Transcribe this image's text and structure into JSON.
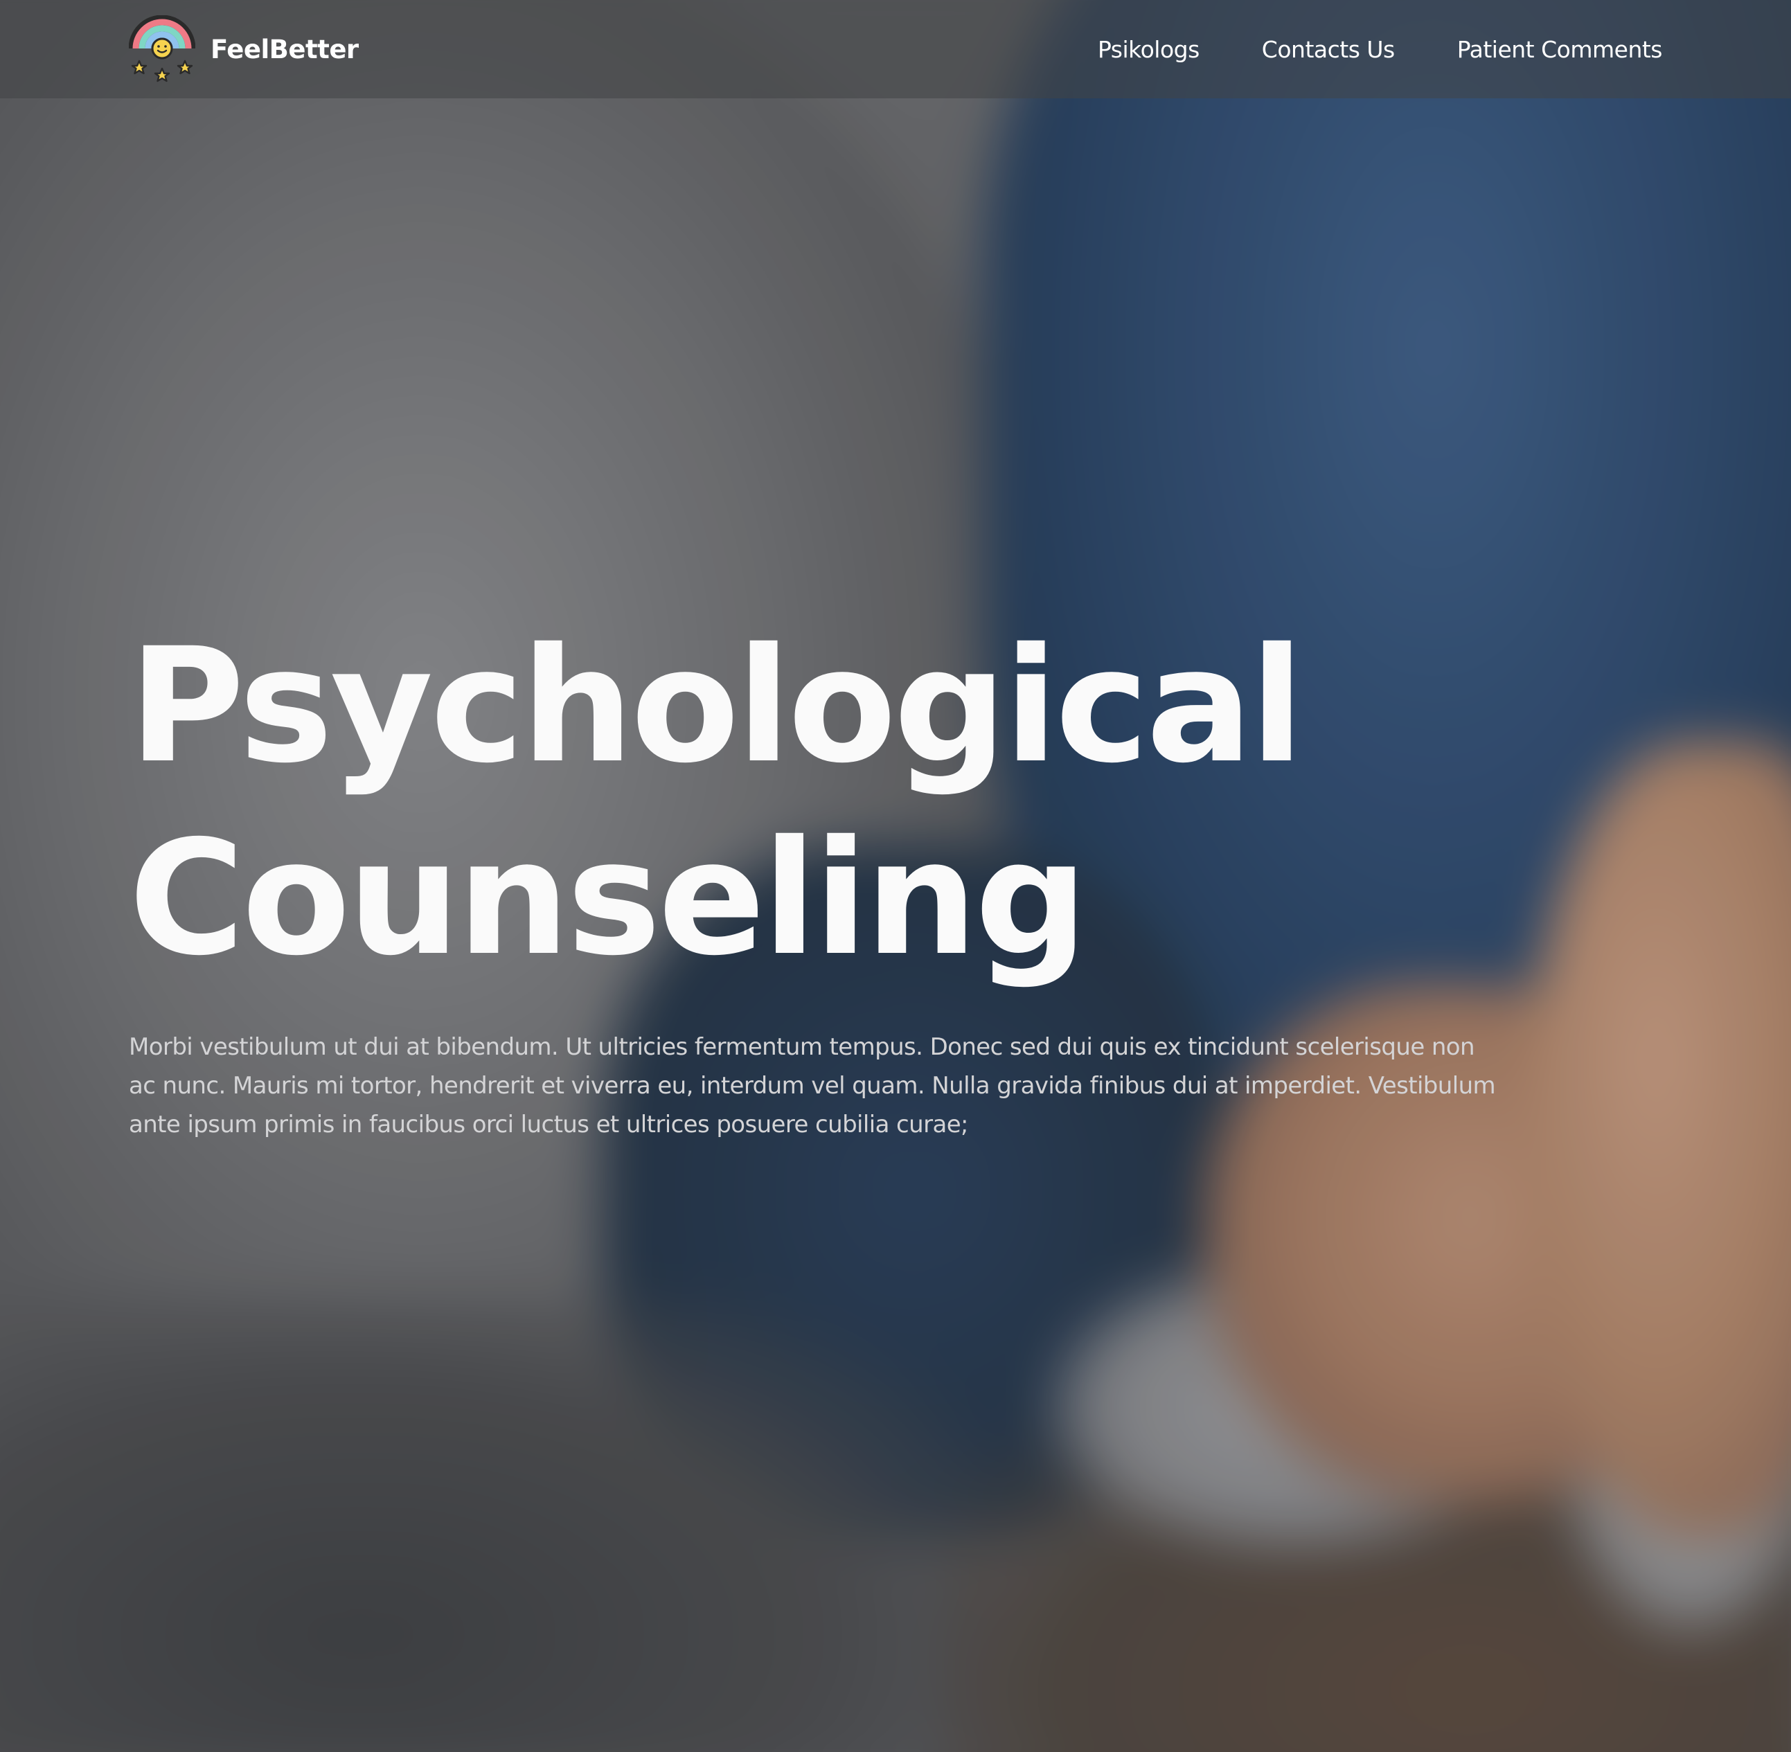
{
  "brand": {
    "name": "FeelBetter",
    "logo_icon": "rainbow-smiley-stars-icon"
  },
  "nav": {
    "items": [
      {
        "label": "Psikologs"
      },
      {
        "label": "Contacts Us"
      },
      {
        "label": "Patient Comments"
      }
    ]
  },
  "hero": {
    "title_line1": "Psychological",
    "title_line2": "Counseling",
    "description": "Morbi vestibulum ut dui at bibendum. Ut ultricies fermentum tempus. Donec sed dui quis ex tincidunt scelerisque non ac nunc. Mauris mi tortor, hendrerit et viverra eu, interdum vel quam. Nulla gravida finibus dui at imperdiet. Vestibulum ante ipsum primis in faucibus orci luctus et ultrices posuere cubilia curae;"
  },
  "colors": {
    "text_primary": "#ffffff",
    "text_muted": "#d4d4d6",
    "navbar_bg": "rgba(66,67,69,0.55)",
    "photo_grey": "#6b6c6e",
    "photo_blue": "#2f4a6c",
    "photo_skin": "#b98f75"
  }
}
